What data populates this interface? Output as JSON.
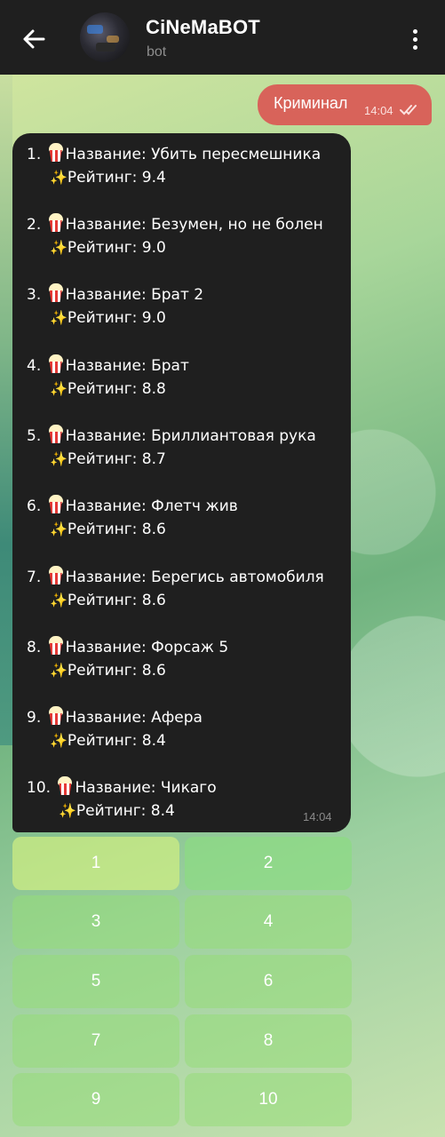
{
  "header": {
    "title": "CiNeMaBOT",
    "subtitle": "bot"
  },
  "outgoing": {
    "text": "Криминал",
    "time": "14:04"
  },
  "bot_message": {
    "time": "14:04",
    "movies": [
      {
        "num": "1.",
        "name_label": "Название: Убить пересмешника",
        "rating_label": "Рейтинг: 9.4"
      },
      {
        "num": "2.",
        "name_label": "Название: Безумен, но не болен",
        "rating_label": "Рейтинг: 9.0"
      },
      {
        "num": "3.",
        "name_label": "Название: Брат 2",
        "rating_label": "Рейтинг: 9.0"
      },
      {
        "num": "4.",
        "name_label": "Название: Брат",
        "rating_label": "Рейтинг: 8.8"
      },
      {
        "num": "5.",
        "name_label": "Название: Бриллиантовая рука",
        "rating_label": "Рейтинг: 8.7"
      },
      {
        "num": "6.",
        "name_label": "Название: Флетч жив",
        "rating_label": "Рейтинг: 8.6"
      },
      {
        "num": "7.",
        "name_label": "Название: Берегись автомобиля",
        "rating_label": "Рейтинг: 8.6"
      },
      {
        "num": "8.",
        "name_label": "Название: Форсаж 5",
        "rating_label": "Рейтинг: 8.6"
      },
      {
        "num": "9.",
        "name_label": "Название: Афера",
        "rating_label": "Рейтинг: 8.4"
      },
      {
        "num": "10.",
        "name_label": "Название: Чикаго",
        "rating_label": "Рейтинг: 8.4"
      }
    ]
  },
  "keyboard": [
    "1",
    "2",
    "3",
    "4",
    "5",
    "6",
    "7",
    "8",
    "9",
    "10"
  ],
  "colors": {
    "header_bg": "#1f1f1f",
    "outgoing_bubble": "#d8635a",
    "incoming_bubble": "#1f1f1f",
    "keyboard_button": "#96dc78"
  },
  "icons": [
    "back-arrow-icon",
    "more-vert-icon",
    "double-check-icon",
    "popcorn-icon",
    "sparkles-icon"
  ]
}
